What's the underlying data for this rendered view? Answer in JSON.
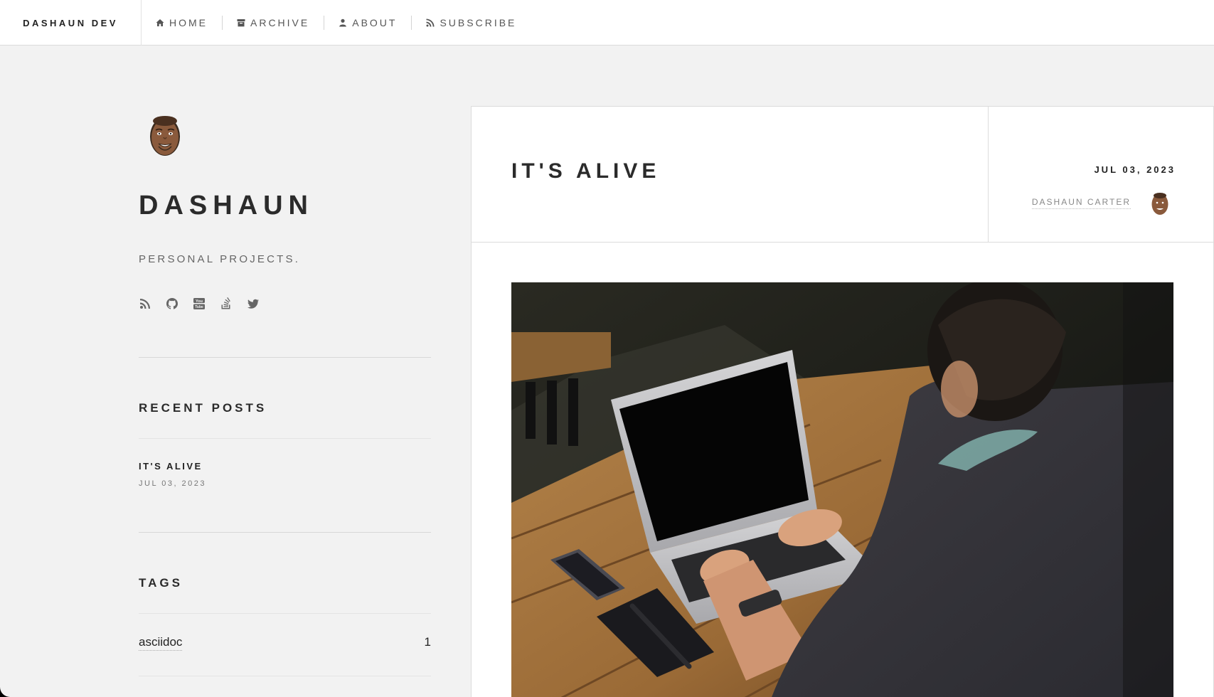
{
  "topbar": {
    "brand": "DASHAUN DEV",
    "nav": [
      {
        "label": "HOME",
        "icon": "home-icon"
      },
      {
        "label": "ARCHIVE",
        "icon": "archive-icon"
      },
      {
        "label": "ABOUT",
        "icon": "user-icon"
      },
      {
        "label": "SUBSCRIBE",
        "icon": "rss-icon"
      }
    ]
  },
  "sidebar": {
    "title": "DASHAUN",
    "description": "PERSONAL PROJECTS.",
    "socials": [
      "rss-icon",
      "github-icon",
      "youtube-icon",
      "stackoverflow-icon",
      "twitter-icon"
    ],
    "recent_heading": "RECENT POSTS",
    "recent_posts": [
      {
        "title": "IT'S ALIVE",
        "date": "JUL 03, 2023"
      }
    ],
    "tags_heading": "TAGS",
    "tags": [
      {
        "name": "asciidoc",
        "count": "1"
      }
    ]
  },
  "article": {
    "title": "IT'S ALIVE",
    "date": "JUL 03, 2023",
    "author": "DASHAUN CARTER"
  }
}
